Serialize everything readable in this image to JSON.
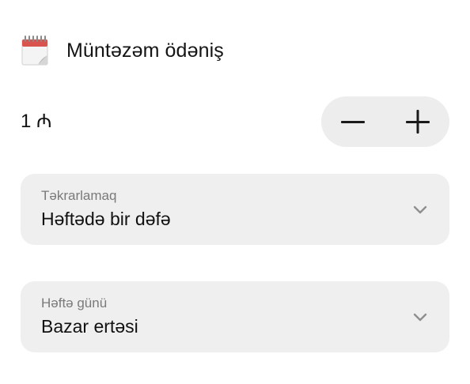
{
  "header": {
    "icon": "calendar-icon",
    "title": "Müntəzəm ödəniş"
  },
  "amount": {
    "value": "1 ₼"
  },
  "stepper": {
    "minus_icon": "minus-icon",
    "plus_icon": "plus-icon"
  },
  "repeat": {
    "label": "Təkrarlamaq",
    "value": "Həftədə bir dəfə",
    "icon": "chevron-down-icon"
  },
  "weekday": {
    "label": "Həftə günü",
    "value": "Bazar ertəsi",
    "icon": "chevron-down-icon"
  },
  "colors": {
    "background": "#ffffff",
    "field_bg": "#efefef",
    "stepper_bg": "#ededed",
    "text": "#111111",
    "muted_text": "#7a7a7a",
    "calendar_red": "#d9534f"
  }
}
